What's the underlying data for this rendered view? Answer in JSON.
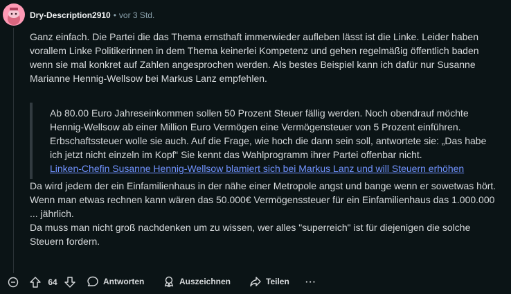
{
  "comment": {
    "author": "Dry-Description2910",
    "separator": "•",
    "timestamp": "vor 3 Std.",
    "paragraph_1": "Ganz einfach. Die Partei die das Thema ernsthaft immerwieder aufleben lässt ist die Linke. Leider haben vorallem Linke Politikerinnen in dem Thema keinerlei Kompetenz und gehen regelmäßig öffentlich baden wenn sie mal konkret auf Zahlen angesprochen werden. Als bestes Beispiel kann ich dafür nur Susanne Marianne Hennig-Wellsow bei Markus Lanz empfehlen.",
    "quote_text": "Ab 80.00 Euro Jahreseinkommen sollen 50 Prozent Steuer fällig werden. Noch obendrauf möchte Hennig-Wellsow ab einer Million Euro Vermögen eine Vermögensteuer von 5 Prozent einführen. Erbschaftssteuer wolle sie auch. Auf die Frage, wie hoch die dann sein soll, antwortete sie: „Das habe ich jetzt nicht einzeln im Kopf“ Sie kennt das Wahlprogramm ihrer Partei offenbar nicht.",
    "quote_link": "Linken-Chefin Susanne Hennig-Wellsow blamiert sich bei Markus Lanz und will Steuern erhöhen",
    "paragraph_2": "Da wird jedem der ein Einfamilienhaus in der nähe einer Metropole angst und bange wenn er sowetwas hört. Wenn man etwas rechnen kann wären das 50.000€ Vermögenssteuer für ein Einfamilienhaus das 1.000.000 ... jährlich.",
    "paragraph_3": "Da muss man nicht groß nachdenken um zu wissen, wer alles \"superreich\" ist für diejenigen die solche Steuern fordern."
  },
  "actions": {
    "vote_count": "64",
    "reply_label": "Antworten",
    "award_label": "Auszeichnen",
    "share_label": "Teilen",
    "more_label": "···"
  },
  "icons": {
    "avatar": "snoo-avatar-icon",
    "collapse": "collapse-minus-icon",
    "upvote": "upvote-arrow-icon",
    "downvote": "downvote-arrow-icon",
    "reply": "speech-bubble-icon",
    "award": "award-medal-icon",
    "share": "share-arrow-icon"
  },
  "colors": {
    "background": "#0b1416",
    "text": "#d7dadc",
    "meta": "#8ba2ad",
    "link": "#7193ff",
    "avatar_bg": "#ff9ab6"
  }
}
